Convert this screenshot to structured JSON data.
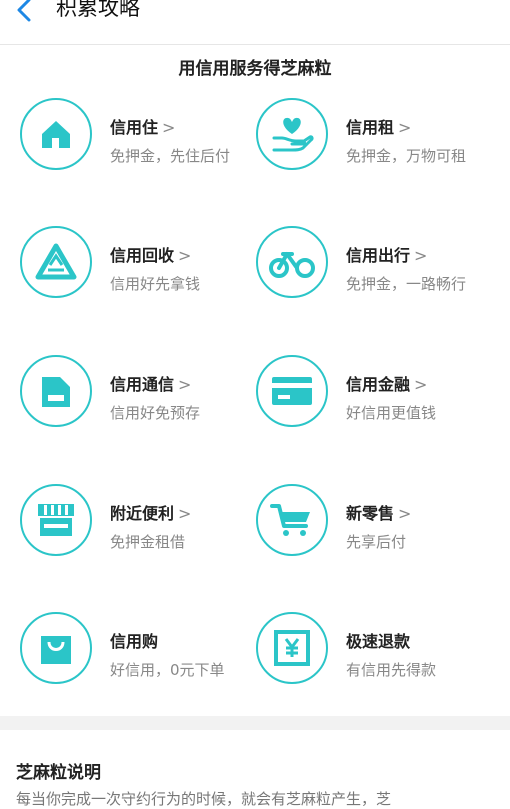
{
  "header": {
    "back_icon": "chevron-left-icon",
    "title": "积累攻略"
  },
  "section": {
    "heading": "用信用服务得芝麻粒"
  },
  "services": [
    {
      "name": "信用住",
      "arrow": ">",
      "desc": "免押金，先住后付",
      "icon": "house-icon"
    },
    {
      "name": "信用租",
      "arrow": ">",
      "desc": "免押金，万物可租",
      "icon": "heart-hand-icon"
    },
    {
      "name": "信用回收",
      "arrow": ">",
      "desc": "信用好先拿钱",
      "icon": "recycle-icon"
    },
    {
      "name": "信用出行",
      "arrow": ">",
      "desc": "免押金，一路畅行",
      "icon": "bike-icon"
    },
    {
      "name": "信用通信",
      "arrow": ">",
      "desc": "信用好免预存",
      "icon": "sim-card-icon"
    },
    {
      "name": "信用金融",
      "arrow": ">",
      "desc": "好信用更值钱",
      "icon": "card-icon"
    },
    {
      "name": "附近便利",
      "arrow": ">",
      "desc": "免押金租借",
      "icon": "store-icon"
    },
    {
      "name": "新零售",
      "arrow": ">",
      "desc": "先享后付",
      "icon": "cart-icon"
    },
    {
      "name": "信用购",
      "arrow": "",
      "desc": "好信用，0元下单",
      "icon": "bag-icon"
    },
    {
      "name": "极速退款",
      "arrow": "",
      "desc": "有信用先得款",
      "icon": "yen-refund-icon"
    }
  ],
  "info": {
    "title": "芝麻粒说明",
    "text": "每当你完成一次守约行为的时候，就会有芝麻粒产生，芝"
  },
  "colors": {
    "accent": "#2bc5c8",
    "back": "#1e88e5"
  }
}
